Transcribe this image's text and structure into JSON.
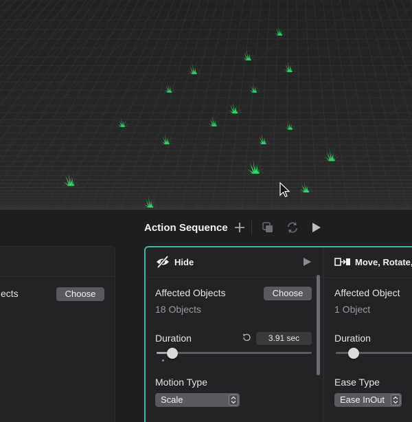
{
  "toolbar": {
    "title": "Action Sequence",
    "icons": [
      "plus-icon",
      "duplicate-icon",
      "repeat-icon",
      "play-icon"
    ]
  },
  "left_card": {
    "label_partial": "ects",
    "choose_label": "Choose"
  },
  "hide_card": {
    "title": "Hide",
    "icon": "eye-slash-icon",
    "affected_label": "Affected Objects",
    "affected_count": "18 Objects",
    "choose_label": "Choose",
    "duration_label": "Duration",
    "duration_value": "3.91 sec",
    "duration_fraction": 0.1,
    "motion_type_label": "Motion Type",
    "motion_type_value": "Scale"
  },
  "move_card": {
    "title": "Move, Rotate,",
    "icon": "move-to-icon",
    "affected_label": "Affected Object",
    "affected_count": "1 Object",
    "duration_label": "Duration",
    "duration_fraction": 0.2,
    "ease_type_label": "Ease Type",
    "ease_type_value": "Ease InOut"
  },
  "colors": {
    "selection_border": "#3fb7a0",
    "grass": "#2fd66b",
    "grid_bg": "#262626"
  }
}
